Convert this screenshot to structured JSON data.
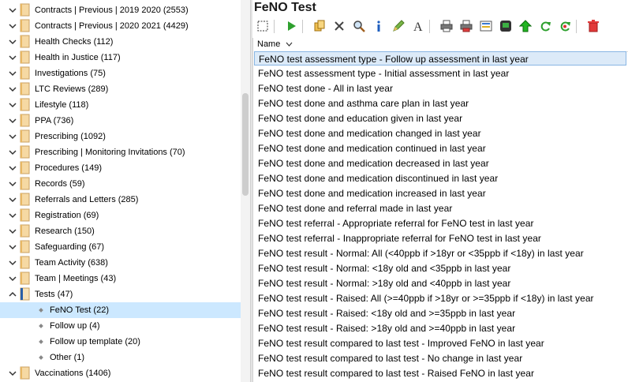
{
  "tree": {
    "items": [
      {
        "label": "Contracts | Previous | 2019 2020 (2553)",
        "expanded": false
      },
      {
        "label": "Contracts | Previous | 2020 2021 (4429)",
        "expanded": false
      },
      {
        "label": "Health Checks (112)",
        "expanded": false
      },
      {
        "label": "Health in Justice (117)",
        "expanded": false
      },
      {
        "label": "Investigations (75)",
        "expanded": false
      },
      {
        "label": "LTC Reviews (289)",
        "expanded": false
      },
      {
        "label": "Lifestyle (118)",
        "expanded": false
      },
      {
        "label": "PPA (736)",
        "expanded": false
      },
      {
        "label": "Prescribing (1092)",
        "expanded": false
      },
      {
        "label": "Prescribing | Monitoring Invitations (70)",
        "expanded": false
      },
      {
        "label": "Procedures (149)",
        "expanded": false
      },
      {
        "label": "Records (59)",
        "expanded": false
      },
      {
        "label": "Referrals and Letters (285)",
        "expanded": false
      },
      {
        "label": "Registration (69)",
        "expanded": false
      },
      {
        "label": "Research (150)",
        "expanded": false
      },
      {
        "label": "Safeguarding (67)",
        "expanded": false
      },
      {
        "label": "Team Activity (638)",
        "expanded": false
      },
      {
        "label": "Team | Meetings (43)",
        "expanded": false
      },
      {
        "label": "Tests (47)",
        "expanded": true
      }
    ],
    "children": [
      {
        "label": "FeNO Test (22)",
        "selected": true
      },
      {
        "label": "Follow up (4)",
        "selected": false
      },
      {
        "label": "Follow up template (20)",
        "selected": false
      },
      {
        "label": "Other (1)",
        "selected": false
      }
    ],
    "after": [
      {
        "label": "Vaccinations (1406)",
        "expanded": false
      }
    ]
  },
  "panel": {
    "title": "FeNO Test",
    "column_name": "Name",
    "toolbar_icons": [
      "select-all-icon",
      "run-icon",
      "copy-icon",
      "delete-icon",
      "search-icon",
      "info-icon",
      "edit-icon",
      "font-icon",
      "print-icon",
      "print-red-icon",
      "export-icon",
      "save-icon",
      "upload-icon",
      "refresh-icon",
      "refresh-red-icon",
      "trash-icon"
    ],
    "rows": [
      "FeNO test assessment type - Follow up assessment in last year",
      "FeNO test assessment type - Initial assessment in last year",
      "FeNO test done - All in last year",
      "FeNO test done and asthma care plan in last year",
      "FeNO test done and education given in last year",
      "FeNO test done and medication changed in last year",
      "FeNO test done and medication continued in last year",
      "FeNO test done and medication decreased in last year",
      "FeNO test done and medication discontinued in last year",
      "FeNO test done and medication increased in last year",
      "FeNO test done and referral made in last year",
      "FeNO test referral - Appropriate referral for FeNO test in last year",
      "FeNO test referral - Inappropriate referral for FeNO test in last year",
      "FeNO test result - Normal:  All (<40ppb if >18yr or <35ppb if <18y) in last year",
      "FeNO test result - Normal: <18y old and <35ppb in last year",
      "FeNO test result - Normal: >18y old and <40ppb in last year",
      "FeNO test result - Raised:  All (>=40ppb if >18yr or >=35ppb if <18y) in last year",
      "FeNO test result - Raised: <18y old and >=35ppb in last year",
      "FeNO test result - Raised: >18y old and >=40ppb in last year",
      "FeNO test result compared to last test - Improved FeNO in last year",
      "FeNO test result compared to last test - No change in last year",
      "FeNO test result compared to last test - Raised FeNO in last year"
    ],
    "selected_row": 0
  }
}
